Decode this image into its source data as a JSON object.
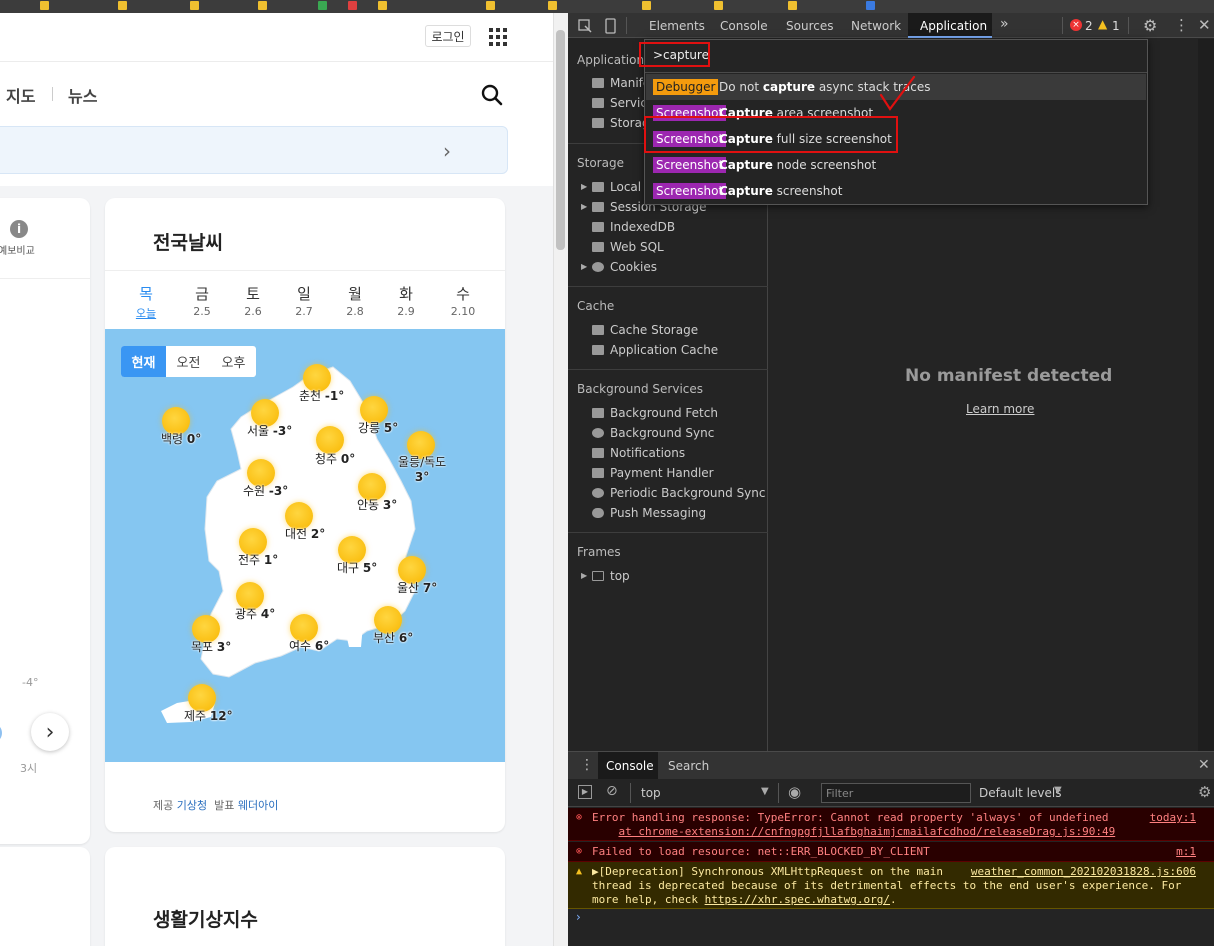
{
  "page": {
    "login": "로그인",
    "nav": {
      "map": "지도",
      "news": "뉴스"
    },
    "left_card": {
      "info_label": "예보비교",
      "temp_marker": "-4°",
      "time_marker": "3시"
    },
    "weather": {
      "title": "전국날씨",
      "days": [
        {
          "day": "목",
          "date": "오늘"
        },
        {
          "day": "금",
          "date": "2.5"
        },
        {
          "day": "토",
          "date": "2.6"
        },
        {
          "day": "일",
          "date": "2.7"
        },
        {
          "day": "월",
          "date": "2.8"
        },
        {
          "day": "화",
          "date": "2.9"
        },
        {
          "day": "수",
          "date": "2.10"
        }
      ],
      "time_tabs": [
        "현재",
        "오전",
        "오후"
      ],
      "cities": [
        {
          "name": "춘천",
          "temp": "-1°"
        },
        {
          "name": "백령",
          "temp": "0°"
        },
        {
          "name": "서울",
          "temp": "-3°"
        },
        {
          "name": "강릉",
          "temp": "5°"
        },
        {
          "name": "청주",
          "temp": "0°"
        },
        {
          "name": "울릉/독도",
          "temp": "3°"
        },
        {
          "name": "수원",
          "temp": "-3°"
        },
        {
          "name": "안동",
          "temp": "3°"
        },
        {
          "name": "대전",
          "temp": "2°"
        },
        {
          "name": "전주",
          "temp": "1°"
        },
        {
          "name": "대구",
          "temp": "5°"
        },
        {
          "name": "울산",
          "temp": "7°"
        },
        {
          "name": "광주",
          "temp": "4°"
        },
        {
          "name": "부산",
          "temp": "6°"
        },
        {
          "name": "목포",
          "temp": "3°"
        },
        {
          "name": "여수",
          "temp": "6°"
        },
        {
          "name": "제주",
          "temp": "12°"
        }
      ],
      "credit": {
        "p1": "제공",
        "src1": "기상청",
        "p2": "발표",
        "src2": "웨더아이"
      }
    },
    "life": {
      "title": "생활기상지수"
    }
  },
  "devtools": {
    "tabs": [
      "Elements",
      "Console",
      "Sources",
      "Network",
      "Application"
    ],
    "active_tab": "Application",
    "error_count": "2",
    "warning_count": "1",
    "sidebar": {
      "application_header": "Application",
      "application_items": [
        "Manifest",
        "Service Workers",
        "Storage"
      ],
      "storage_header": "Storage",
      "storage_items": [
        "Local Storage",
        "Session Storage",
        "IndexedDB",
        "Web SQL",
        "Cookies"
      ],
      "cache_header": "Cache",
      "cache_items": [
        "Cache Storage",
        "Application Cache"
      ],
      "bg_header": "Background Services",
      "bg_items": [
        "Background Fetch",
        "Background Sync",
        "Notifications",
        "Payment Handler",
        "Periodic Background Sync",
        "Push Messaging"
      ],
      "frames_header": "Frames",
      "frames_items": [
        "top"
      ]
    },
    "main": {
      "no_manifest": "No manifest detected",
      "learn_more": "Learn more"
    },
    "command_menu": {
      "query": ">capture",
      "items": [
        {
          "badge": "Debugger",
          "pre": "Do not ",
          "bold": "capture",
          "post": " async stack traces"
        },
        {
          "badge": "Screenshot",
          "pre": "",
          "bold": "Capture",
          "post": " area screenshot"
        },
        {
          "badge": "Screenshot",
          "pre": "",
          "bold": "Capture",
          "post": " full size screenshot"
        },
        {
          "badge": "Screenshot",
          "pre": "",
          "bold": "Capture",
          "post": " node screenshot"
        },
        {
          "badge": "Screenshot",
          "pre": "",
          "bold": "Capture",
          "post": " screenshot"
        }
      ]
    },
    "drawer": {
      "tabs": [
        "Console",
        "Search"
      ],
      "context": "top",
      "filter_placeholder": "Filter",
      "levels": "Default levels",
      "messages": [
        {
          "type": "error",
          "text": "Error handling response: TypeError: Cannot read property 'always' of undefined",
          "text2": "at chrome-extension://cnfngpgfjllafbghaimjcmailafcdhod/releaseDrag.js:90:49",
          "source": "today:1"
        },
        {
          "type": "error",
          "text": "Failed to load resource: net::ERR_BLOCKED_BY_CLIENT",
          "source": "m:1"
        },
        {
          "type": "warning",
          "text": "▶[Deprecation] Synchronous XMLHttpRequest on the main",
          "text2": "thread is deprecated because of its detrimental effects to the end user's experience. For",
          "text3": "more help, check ",
          "link": "https://xhr.spec.whatwg.org/",
          "source": "weather_common_20210203182​8.js:606"
        }
      ]
    }
  }
}
